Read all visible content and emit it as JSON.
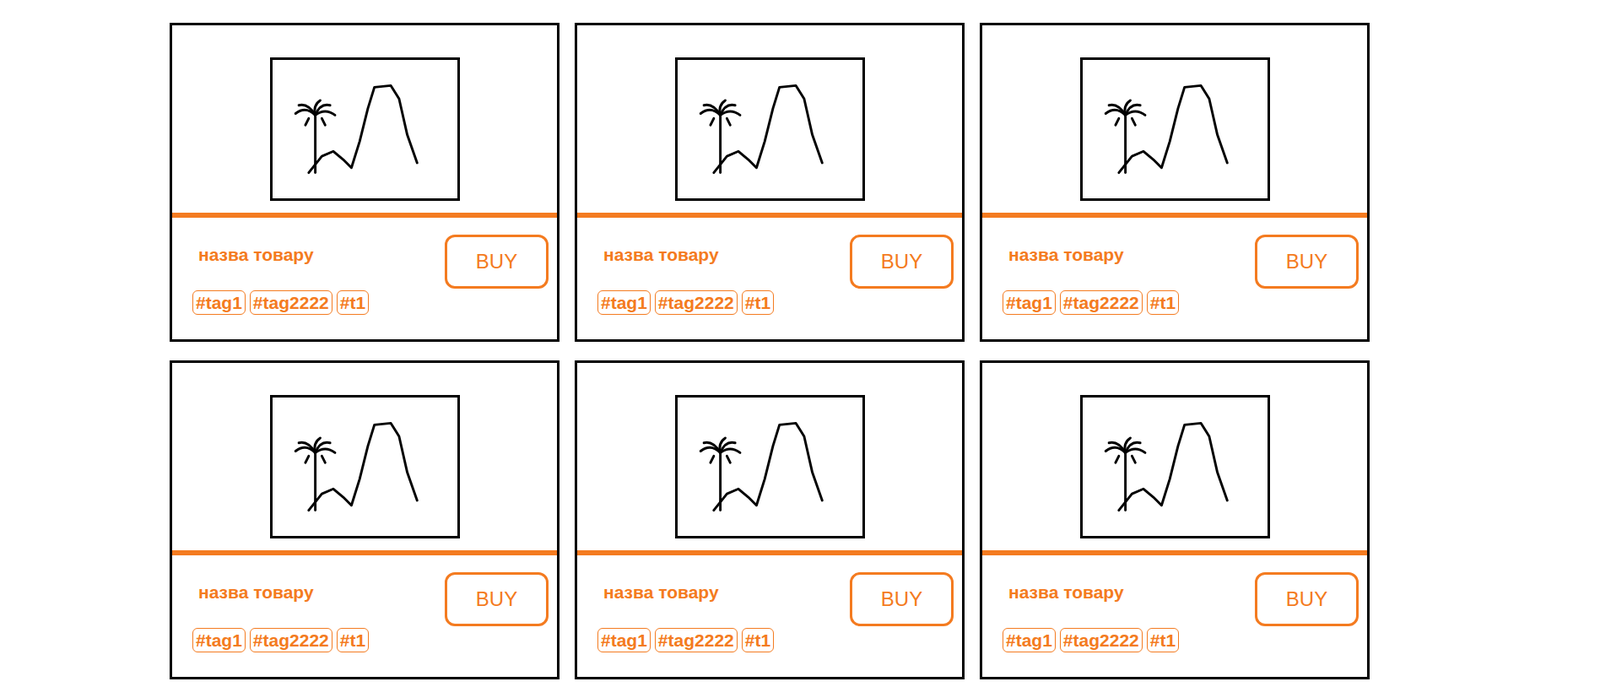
{
  "cards": [
    {
      "title": "назва товару",
      "button": "BUY",
      "tags": [
        "#tag1",
        "#tag2222",
        "#t1"
      ]
    },
    {
      "title": "назва товару",
      "button": "BUY",
      "tags": [
        "#tag1",
        "#tag2222",
        "#t1"
      ]
    },
    {
      "title": "назва товару",
      "button": "BUY",
      "tags": [
        "#tag1",
        "#tag2222",
        "#t1"
      ]
    },
    {
      "title": "назва товару",
      "button": "BUY",
      "tags": [
        "#tag1",
        "#tag2222",
        "#t1"
      ]
    },
    {
      "title": "назва товару",
      "button": "BUY",
      "tags": [
        "#tag1",
        "#tag2222",
        "#t1"
      ]
    },
    {
      "title": "назва товару",
      "button": "BUY",
      "tags": [
        "#tag1",
        "#tag2222",
        "#t1"
      ]
    }
  ]
}
